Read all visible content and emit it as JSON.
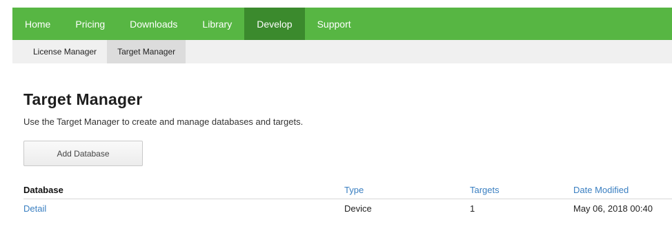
{
  "topnav": {
    "items": [
      {
        "label": "Home"
      },
      {
        "label": "Pricing"
      },
      {
        "label": "Downloads"
      },
      {
        "label": "Library"
      },
      {
        "label": "Develop"
      },
      {
        "label": "Support"
      }
    ],
    "active": "Develop"
  },
  "subnav": {
    "items": [
      {
        "label": "License Manager"
      },
      {
        "label": "Target Manager"
      }
    ],
    "active": "Target Manager"
  },
  "main": {
    "title": "Target Manager",
    "description": "Use the Target Manager to create and manage databases and targets.",
    "add_button_label": "Add Database"
  },
  "table": {
    "headers": {
      "database": "Database",
      "type": "Type",
      "targets": "Targets",
      "date_modified": "Date Modified"
    },
    "rows": [
      {
        "database": "Detail",
        "type": "Device",
        "targets": "1",
        "date_modified": "May 06, 2018 00:40"
      }
    ]
  },
  "colors": {
    "nav_green": "#57b643",
    "nav_active": "#3b8a2d",
    "link_blue": "#3a7fc1"
  }
}
